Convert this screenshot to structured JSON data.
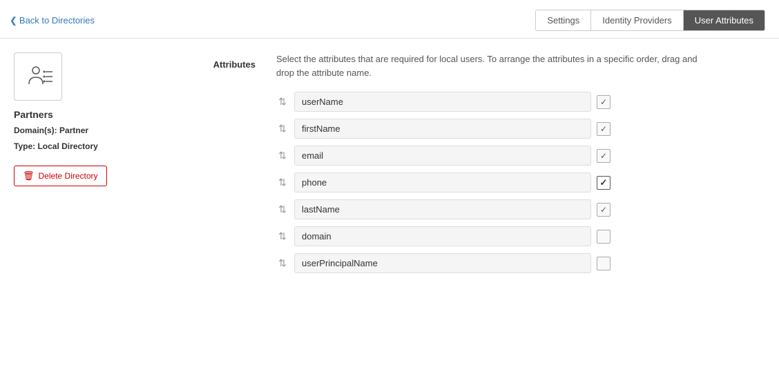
{
  "header": {
    "back_label": "Back to Directories",
    "tabs": [
      {
        "id": "settings",
        "label": "Settings",
        "active": false
      },
      {
        "id": "identity-providers",
        "label": "Identity Providers",
        "active": false
      },
      {
        "id": "user-attributes",
        "label": "User Attributes",
        "active": true
      }
    ]
  },
  "sidebar": {
    "dir_name": "Partners",
    "domain_label": "Domain(s):",
    "domain_value": "Partner",
    "type_label": "Type:",
    "type_value": "Local Directory",
    "delete_label": "Delete Directory"
  },
  "content": {
    "attributes_label": "Attributes",
    "description": "Select the attributes that are required for local users. To arrange the attributes in a specific order, drag and drop the attribute name.",
    "attributes": [
      {
        "name": "userName",
        "checked": true,
        "checked_solid": false
      },
      {
        "name": "firstName",
        "checked": true,
        "checked_solid": false
      },
      {
        "name": "email",
        "checked": true,
        "checked_solid": false
      },
      {
        "name": "phone",
        "checked": true,
        "checked_solid": true
      },
      {
        "name": "lastName",
        "checked": true,
        "checked_solid": false
      },
      {
        "name": "domain",
        "checked": false,
        "checked_solid": false
      },
      {
        "name": "userPrincipalName",
        "checked": false,
        "checked_solid": false
      }
    ]
  },
  "icons": {
    "chevron_left": "❮",
    "drag": "⇅",
    "trash": "🗑"
  }
}
